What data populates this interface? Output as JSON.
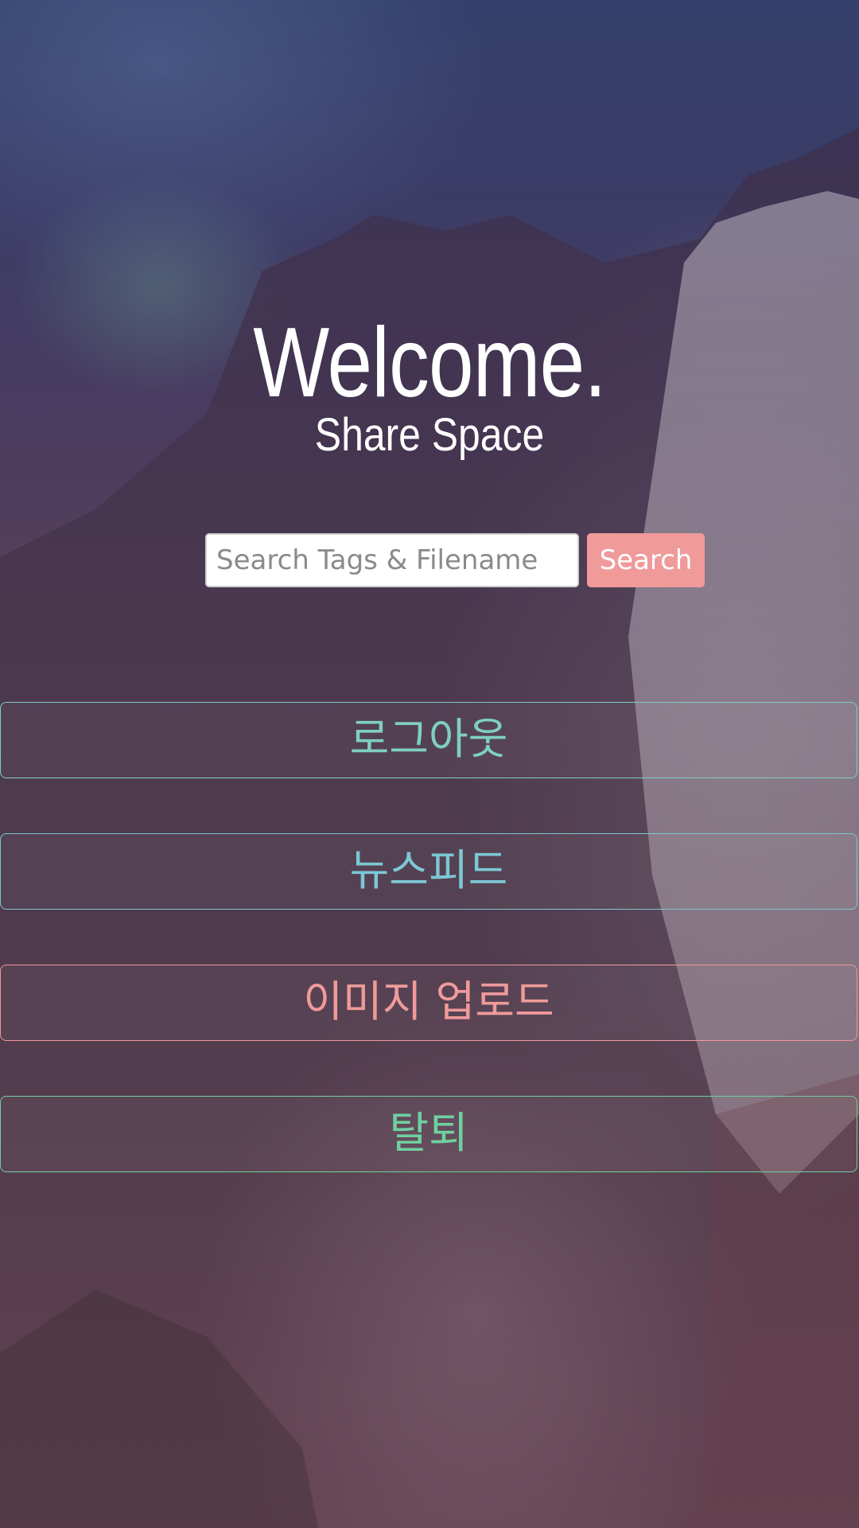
{
  "header": {
    "title": "Welcome.",
    "subtitle": "Share Space"
  },
  "search": {
    "placeholder": "Search Tags & Filename",
    "value": "",
    "button_label": "Search",
    "button_color": "#f09a9a"
  },
  "menu": [
    {
      "label": "로그아웃",
      "color": "#7fcfc0"
    },
    {
      "label": "뉴스피드",
      "color": "#7cc8d4"
    },
    {
      "label": "이미지 업로드",
      "color": "#f09a9a"
    },
    {
      "label": "탈퇴",
      "color": "#6fd0a0"
    }
  ]
}
